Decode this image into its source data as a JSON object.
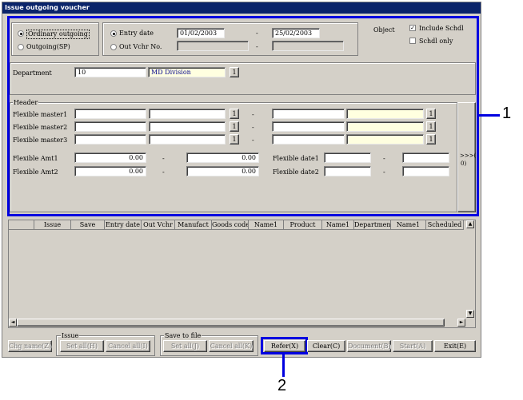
{
  "window": {
    "title": "Issue outgoing voucher"
  },
  "radios": {
    "ordinary_outgoing": "Ordinary outgoing",
    "outgoing_sp": "Outgoing(SP)",
    "entry_date": "Entry date",
    "out_vchr_no": "Out Vchr No."
  },
  "dates": {
    "from": "01/02/2003",
    "dash": "-",
    "to": "25/02/2003"
  },
  "object": {
    "label": "Object",
    "include_schedule": "Include Schdl",
    "schedule_only": "Schdl only",
    "include_checked_mark": "✓"
  },
  "department": {
    "label": "Department",
    "code": "10",
    "name": "MD Division",
    "lookup": "1"
  },
  "header": {
    "label": "Header",
    "flex_master1": "Flexible master1",
    "flex_master2": "Flexible master2",
    "flex_master3": "Flexible master3",
    "lookup": "1",
    "dash": "-",
    "flex_amt1": "Flexible Amt1",
    "flex_amt2": "Flexible Amt2",
    "amt_value": "0.00",
    "flex_date1": "Flexible date1",
    "flex_date2": "Flexible date2",
    "expand_label_1": ">>>(",
    "expand_label_2": "0)"
  },
  "grid": {
    "columns": [
      "Issue",
      "Save",
      "Entry date",
      "Out Vchr",
      "Manufact",
      "Goods code",
      "Name1",
      "Product",
      "Name1",
      "Departmen",
      "Name1",
      "Scheduled"
    ]
  },
  "scroll": {
    "up": "▲",
    "down": "▼",
    "left": "◄",
    "right": "►"
  },
  "buttons": {
    "chg_name": "Chg name(Z)",
    "issue_group": "Issue",
    "set_all_h": "Set all(H)",
    "cancel_all_i": "Cancel all(I)",
    "save_group": "Save to file",
    "set_all_j": "Set all(J)",
    "cancel_all_k": "Cancel all(K)",
    "refer": "Refer(X)",
    "clear": "Clear(C)",
    "document": "Document(B)",
    "start": "Start(A)",
    "exit": "Exit(E)"
  },
  "callouts": {
    "one": "1",
    "two": "2"
  }
}
